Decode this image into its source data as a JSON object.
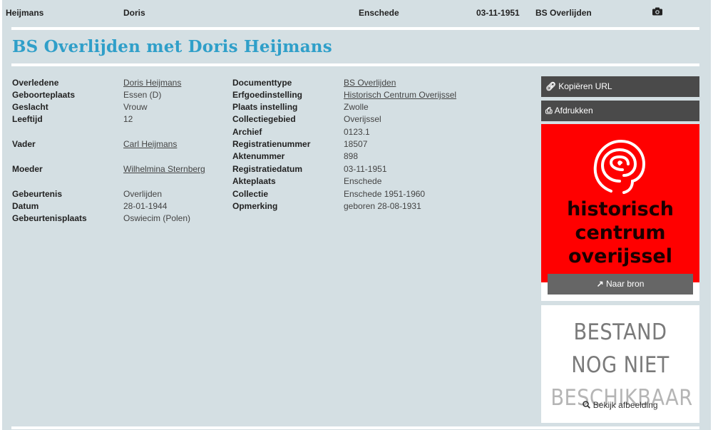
{
  "summary": {
    "surname": "Heijmans",
    "firstname": "Doris",
    "place": "Enschede",
    "date": "03-11-1951",
    "source_type": "BS Overlijden",
    "camera_icon": "camera-icon"
  },
  "title": "BS Overlijden met Doris Heijmans",
  "person": [
    {
      "label": "Overledene",
      "value": "Doris Heijmans",
      "link": true
    },
    {
      "label": "Geboorteplaats",
      "value": "Essen (D)",
      "link": false
    },
    {
      "label": "Geslacht",
      "value": "Vrouw",
      "link": false
    },
    {
      "label": "Leeftijd",
      "value": "12",
      "link": false
    },
    {
      "label": "Vader",
      "value": "Carl Heijmans",
      "link": true
    },
    {
      "label": "Moeder",
      "value": "Wilhelmina Sternberg",
      "link": true
    },
    {
      "label": "Gebeurtenis",
      "value": "Overlijden",
      "link": false
    },
    {
      "label": "Datum",
      "value": "28-01-1944",
      "link": false
    },
    {
      "label": "Gebeurtenisplaats",
      "value": "Oswiecim (Polen)",
      "link": false
    }
  ],
  "document": [
    {
      "label": "Documenttype",
      "value": "BS Overlijden",
      "link": true
    },
    {
      "label": "Erfgoedinstelling",
      "value": "Historisch Centrum Overijssel",
      "link": true
    },
    {
      "label": "Plaats instelling",
      "value": "Zwolle",
      "link": false
    },
    {
      "label": "Collectiegebied",
      "value": "Overijssel",
      "link": false
    },
    {
      "label": "Archief",
      "value": "0123.1",
      "link": false
    },
    {
      "label": "Registratienummer",
      "value": "18507",
      "link": false
    },
    {
      "label": "Aktenummer",
      "value": "898",
      "link": false
    },
    {
      "label": "Registratiedatum",
      "value": "03-11-1951",
      "link": false
    },
    {
      "label": "Akteplaats",
      "value": "Enschede",
      "link": false
    },
    {
      "label": "Collectie",
      "value": "Enschede 1951-1960",
      "link": false
    },
    {
      "label": "Opmerking",
      "value": "geboren 28-08-1931",
      "link": false
    }
  ],
  "actions": {
    "copy_url": "Kopiëren URL",
    "print": "Afdrukken",
    "naar_bron": "Naar bron",
    "bekijk": "Bekijk afbeelding"
  },
  "logo": {
    "line1": "historisch",
    "line2": "centrum",
    "line3": "overijssel"
  },
  "preview": {
    "line1": "BESTAND",
    "line2": "NOG NIET",
    "line3": "BESCHIKBAAR"
  },
  "colors": {
    "title": "#2f9fc9",
    "background": "#d4dfe3",
    "logo_red": "#ff0000",
    "button_dark": "#4a4a4a"
  }
}
